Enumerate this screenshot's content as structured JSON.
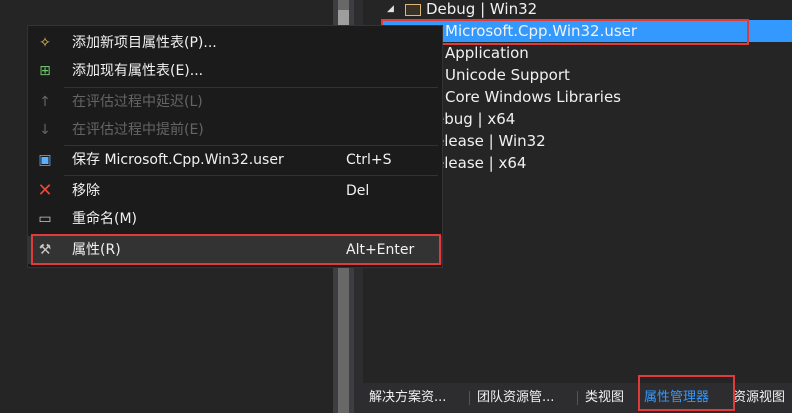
{
  "tree": {
    "items": [
      {
        "label": "Debug | Win32"
      },
      {
        "label": "Microsoft.Cpp.Win32.user"
      },
      {
        "label": "Application"
      },
      {
        "label": "Unicode Support"
      },
      {
        "label": "Core Windows Libraries"
      },
      {
        "label": "ebug | x64"
      },
      {
        "label": "elease | Win32"
      },
      {
        "label": "elease | x64"
      }
    ]
  },
  "menu": {
    "items": [
      {
        "icon": "wand-icon",
        "label": "添加新项目属性表(P)...",
        "shortcut": ""
      },
      {
        "icon": "add-existing-icon",
        "label": "添加现有属性表(E)...",
        "shortcut": ""
      },
      {
        "icon": "arrow-up-icon",
        "label": "在评估过程中延迟(L)",
        "shortcut": ""
      },
      {
        "icon": "arrow-down-icon",
        "label": "在评估过程中提前(E)",
        "shortcut": ""
      },
      {
        "icon": "save-icon",
        "label": "保存 Microsoft.Cpp.Win32.user",
        "shortcut": "Ctrl+S"
      },
      {
        "icon": "remove-icon",
        "label": "移除",
        "shortcut": "Del"
      },
      {
        "icon": "rename-icon",
        "label": "重命名(M)",
        "shortcut": ""
      },
      {
        "icon": "wrench-icon",
        "label": "属性(R)",
        "shortcut": "Alt+Enter"
      }
    ]
  },
  "tabs": [
    {
      "label": "解决方案资..."
    },
    {
      "label": "团队资源管..."
    },
    {
      "label": "类视图"
    },
    {
      "label": "属性管理器"
    },
    {
      "label": "资源视图"
    }
  ],
  "colors": {
    "accent": "#3399ff",
    "highlight_border": "#e03a3a",
    "background": "#252526"
  }
}
